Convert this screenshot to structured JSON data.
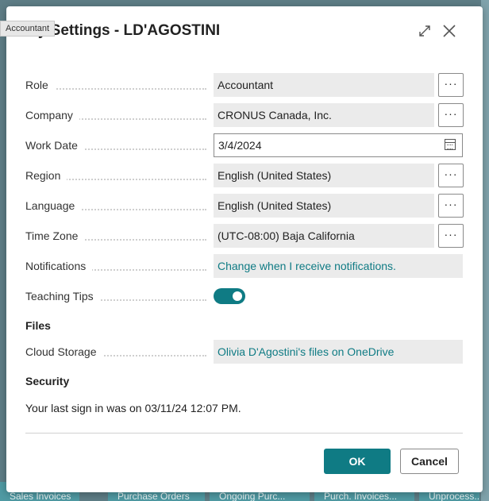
{
  "tooltip": "Accountant",
  "dialog": {
    "title": "My Settings - LD'AGOSTINI"
  },
  "fields": {
    "role": {
      "label": "Role",
      "value": "Accountant"
    },
    "company": {
      "label": "Company",
      "value": "CRONUS Canada, Inc."
    },
    "work_date": {
      "label": "Work Date",
      "value": "3/4/2024"
    },
    "region": {
      "label": "Region",
      "value": "English (United States)"
    },
    "language": {
      "label": "Language",
      "value": "English (United States)"
    },
    "time_zone": {
      "label": "Time Zone",
      "value": "(UTC-08:00) Baja California"
    },
    "notifications": {
      "label": "Notifications",
      "value": "Change when I receive notifications."
    },
    "teaching_tips": {
      "label": "Teaching Tips",
      "on": true
    },
    "cloud_storage": {
      "label": "Cloud Storage",
      "value": "Olivia D'Agostini's files on OneDrive"
    }
  },
  "more_label": "···",
  "sections": {
    "files": "Files",
    "security": "Security"
  },
  "security_text": "Your last sign in was on 03/11/24 12:07 PM.",
  "buttons": {
    "ok": "OK",
    "cancel": "Cancel"
  },
  "background_tiles": [
    "Sales Invoices",
    "Purchase Orders",
    "Ongoing Purc...",
    "Purch. Invoices...",
    "Unprocess..."
  ],
  "colors": {
    "accent": "#0f7b84",
    "field_bg": "#ebebeb"
  }
}
